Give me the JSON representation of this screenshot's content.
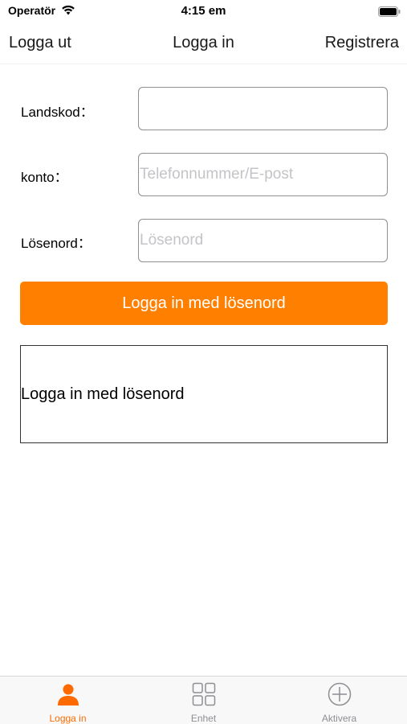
{
  "status_bar": {
    "carrier": "Operatör",
    "time": "4:15 em"
  },
  "nav": {
    "left_label": "Logga ut",
    "title": "Logga in",
    "right_label": "Registrera"
  },
  "form": {
    "country_code": {
      "label": "Landskod：",
      "value": "",
      "placeholder": ""
    },
    "account": {
      "label": "konto：",
      "value": "",
      "placeholder": "Telefonnummer/E-post"
    },
    "password": {
      "label": "Lösenord：",
      "value": "",
      "placeholder": "Lösenord"
    }
  },
  "login_button_label": "Logga in med lösenord",
  "secondary_box_label": "Logga in med lösenord",
  "tab_bar": {
    "items": [
      {
        "label": "Logga in",
        "icon": "person-icon",
        "active": true
      },
      {
        "label": "Enhet",
        "icon": "grid-icon",
        "active": false
      },
      {
        "label": "Aktivera",
        "icon": "plus-circle-icon",
        "active": false
      }
    ]
  },
  "colors": {
    "accent": "#ff8000",
    "tab_active": "#ff6a00",
    "tab_inactive": "#8e8e93"
  }
}
